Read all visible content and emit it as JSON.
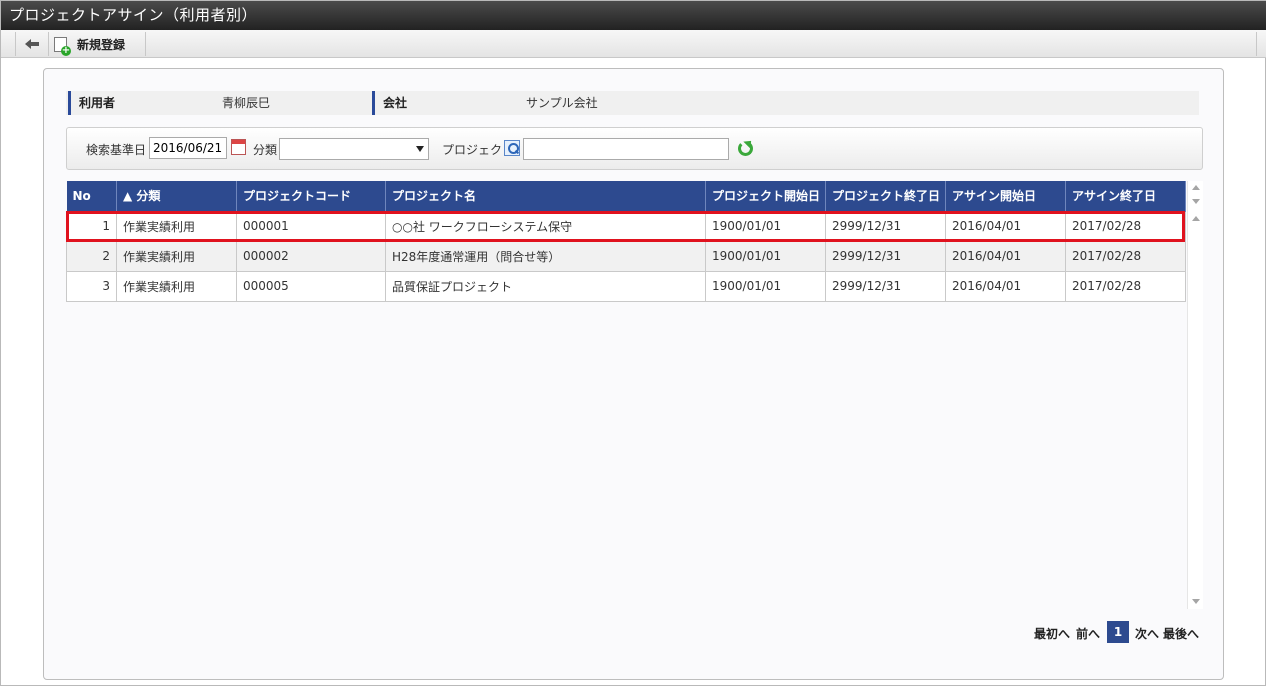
{
  "window": {
    "title": "プロジェクトアサイン（利用者別）"
  },
  "toolbar": {
    "back_label": "",
    "new_label": "新規登録"
  },
  "info": {
    "user_label": "利用者",
    "user_value": "青柳辰巳",
    "company_label": "会社",
    "company_value": "サンプル会社"
  },
  "search": {
    "date_label": "検索基準日",
    "date_value": "2016/06/21",
    "category_label": "分類",
    "category_value": "",
    "project_label": "プロジェクト",
    "project_value": ""
  },
  "table": {
    "headers": [
      "No",
      "▲ 分類",
      "プロジェクトコード",
      "プロジェクト名",
      "プロジェクト開始日",
      "プロジェクト終了日",
      "アサイン開始日",
      "アサイン終了日"
    ],
    "rows": [
      [
        "1",
        "作業実績利用",
        "000001",
        "○○社 ワークフローシステム保守",
        "1900/01/01",
        "2999/12/31",
        "2016/04/01",
        "2017/02/28"
      ],
      [
        "2",
        "作業実績利用",
        "000002",
        "H28年度通常運用（問合せ等）",
        "1900/01/01",
        "2999/12/31",
        "2016/04/01",
        "2017/02/28"
      ],
      [
        "3",
        "作業実績利用",
        "000005",
        "品質保証プロジェクト",
        "1900/01/01",
        "2999/12/31",
        "2016/04/01",
        "2017/02/28"
      ]
    ],
    "selected_row": 1
  },
  "pager": {
    "first": "最初へ",
    "prev": "前へ",
    "current": "1",
    "next": "次へ",
    "last": "最後へ"
  },
  "colors": {
    "header_bg": "#2d4a8f",
    "highlight": "#e0121e",
    "title_bg": "#2a2a2a"
  }
}
